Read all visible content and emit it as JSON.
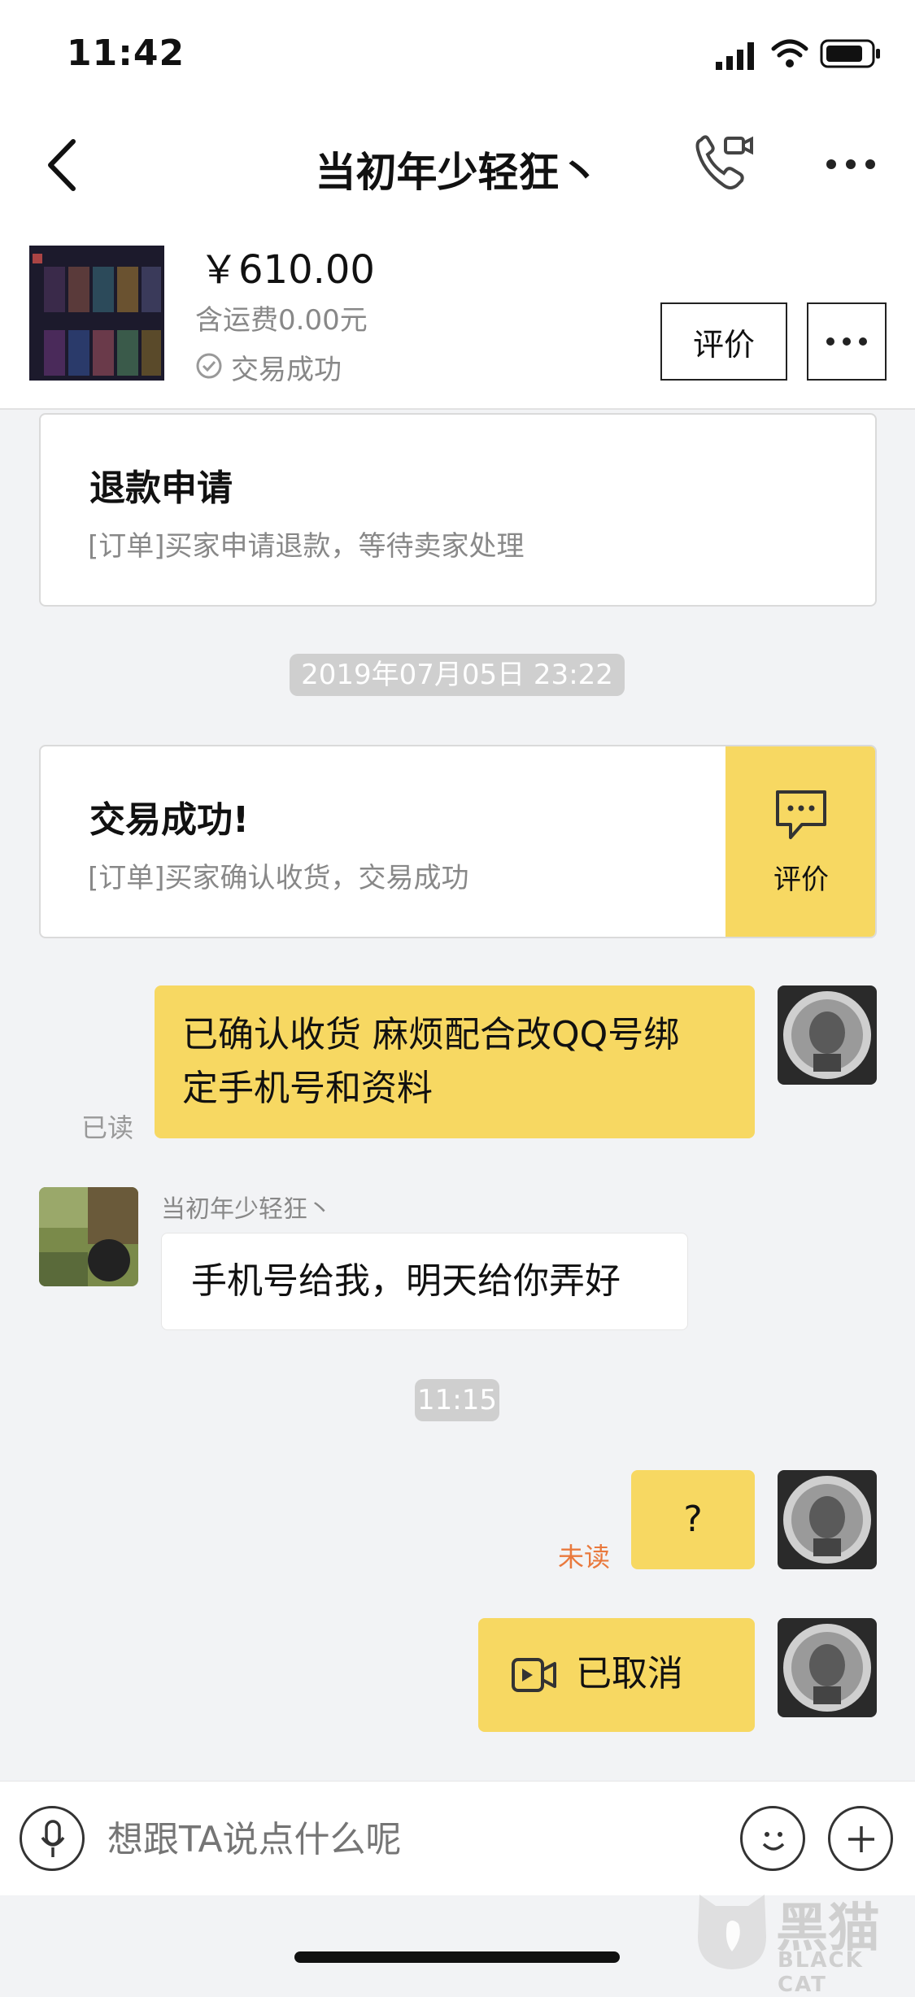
{
  "status": {
    "time": "11:42"
  },
  "nav": {
    "title": "当初年少轻狂丶"
  },
  "product": {
    "price": "￥610.00",
    "shipping": "含运费0.00元",
    "deal_status": "交易成功",
    "review_label": "评价"
  },
  "cards": {
    "refund": {
      "title": "退款申请",
      "subtitle": "[订单]买家申请退款，等待卖家处理"
    },
    "timestamp1": "2019年07月05日 23:22",
    "success": {
      "title": "交易成功!",
      "subtitle": "[订单]买家确认收货，交易成功",
      "action_label": "评价"
    }
  },
  "messages": {
    "m1": {
      "line1": "已确认收货 麻烦配合改QQ号绑",
      "line2": "定手机号和资料",
      "status": "已读"
    },
    "m2": {
      "sender": "当初年少轻狂丶",
      "text": "手机号给我，明天给你弄好"
    },
    "timestamp2": "11:15",
    "m3": {
      "text": "?",
      "status": "未读"
    },
    "m4": {
      "text": "已取消"
    }
  },
  "input": {
    "placeholder": "想跟TA说点什么呢"
  },
  "watermark": {
    "text_cn": "黑猫",
    "text_en": "BLACK CAT"
  },
  "colors": {
    "accent_yellow": "#F7D862",
    "unread_orange": "#E9793D",
    "background": "#F2F3F5"
  },
  "icons": [
    "back-icon",
    "video-call-icon",
    "more-icon",
    "check-circle-icon",
    "chat-icon",
    "video-icon",
    "microphone-icon",
    "emoji-icon",
    "plus-icon"
  ]
}
